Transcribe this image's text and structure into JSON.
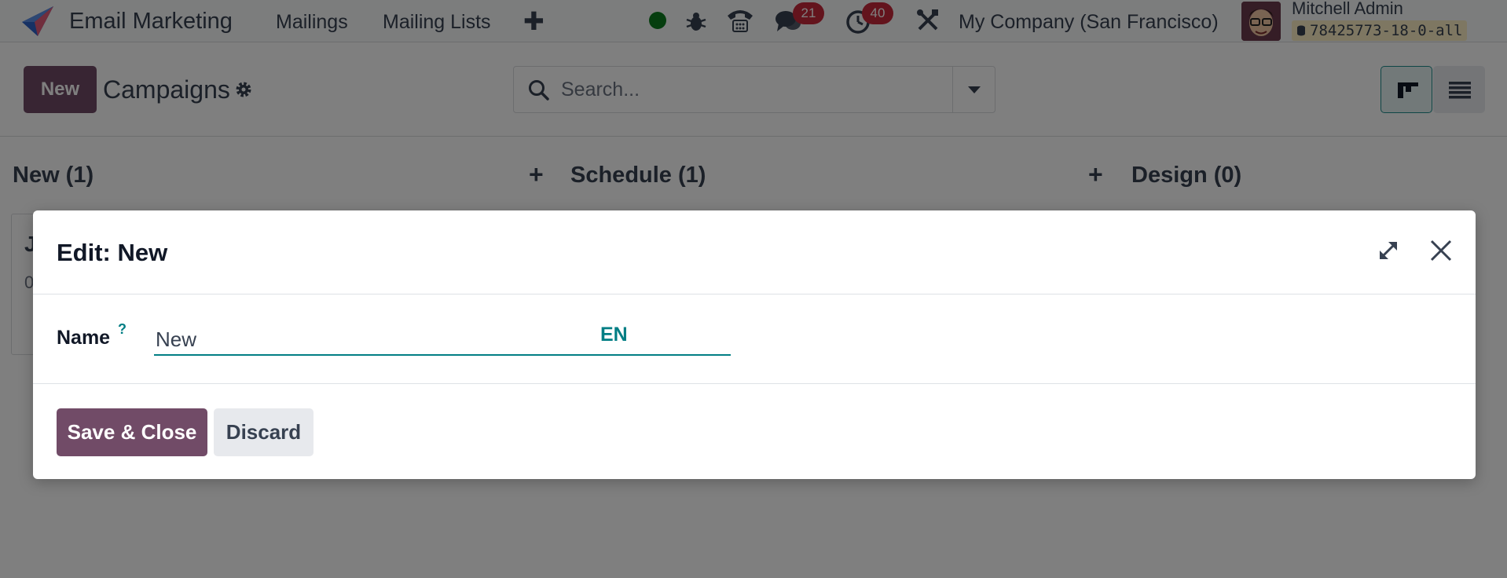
{
  "app": {
    "title": "Email Marketing",
    "nav": [
      "Mailings",
      "Mailing Lists"
    ],
    "company": "My Company (San Francisco)",
    "user_name": "Mitchell Admin",
    "database": "78425773-18-0-all",
    "messages_count": "21",
    "activities_count": "40"
  },
  "control_panel": {
    "new_label": "New",
    "page_title": "Campaigns",
    "search_placeholder": "Search..."
  },
  "kanban": {
    "columns": [
      {
        "title": "New (1)"
      },
      {
        "title": "Schedule (1)"
      },
      {
        "title": "Design (0)"
      }
    ],
    "card": {
      "letter": "J",
      "sub": "0"
    }
  },
  "dialog": {
    "title": "Edit: New",
    "field_label": "Name",
    "help_mark": "?",
    "field_value": "New",
    "lang_code": "EN",
    "save_label": "Save & Close",
    "discard_label": "Discard"
  },
  "colors": {
    "brand": "#714b67",
    "accent": "#017e84",
    "badge": "#c7293b",
    "presence": "#0c7c1f"
  },
  "icons": [
    "app-logo-icon",
    "plus-icon",
    "bug-icon",
    "phone-icon",
    "chat-icon",
    "clock-icon",
    "tools-icon",
    "gear-icon",
    "search-icon",
    "kanban-view-icon",
    "list-view-icon",
    "expand-icon",
    "close-icon",
    "database-icon"
  ]
}
